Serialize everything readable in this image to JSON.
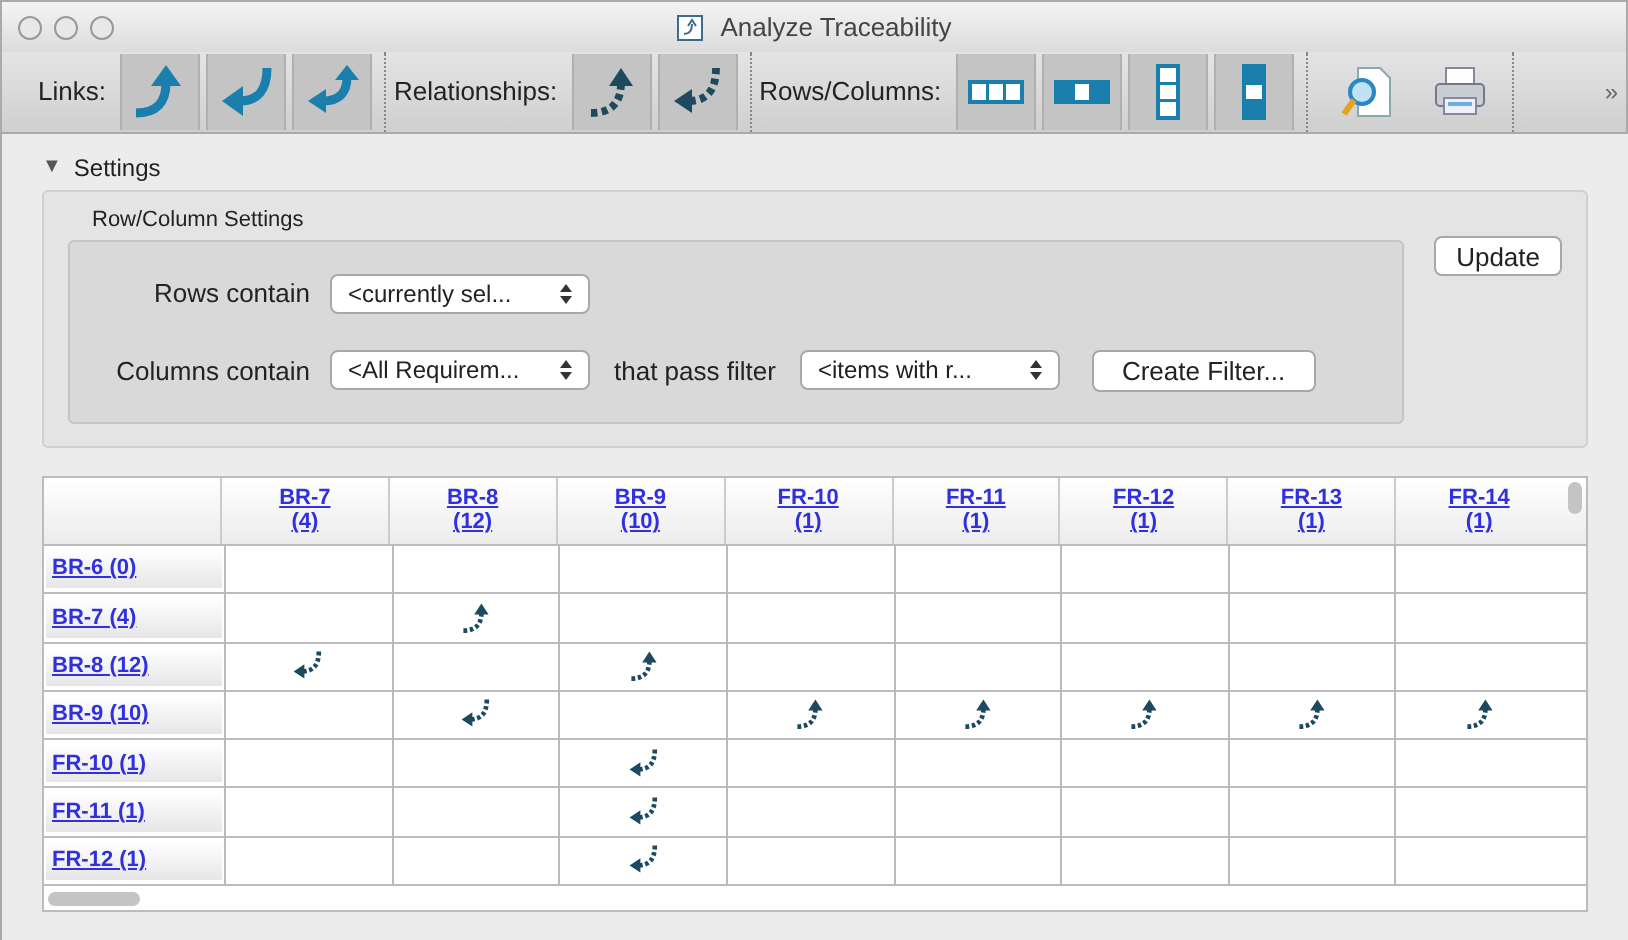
{
  "window": {
    "title": "Analyze Traceability"
  },
  "toolbar": {
    "groups": [
      {
        "label": "Links:",
        "buttons": [
          {
            "kind": "link-out"
          },
          {
            "kind": "link-in"
          },
          {
            "kind": "link-both"
          }
        ]
      },
      {
        "label": "Relationships:",
        "buttons": [
          {
            "kind": "rel-out"
          },
          {
            "kind": "rel-in"
          }
        ]
      },
      {
        "label": "Rows/Columns:",
        "buttons": [
          {
            "kind": "cols-3"
          },
          {
            "kind": "cols-1"
          },
          {
            "kind": "rows-3"
          },
          {
            "kind": "rows-1"
          }
        ]
      }
    ],
    "tools": [
      {
        "kind": "preview"
      },
      {
        "kind": "print"
      }
    ],
    "overflow": "»"
  },
  "settings": {
    "disclosure": "▼",
    "title": "Settings",
    "expanded": true,
    "group_title": "Row/Column Settings",
    "rows_label": "Rows contain",
    "rows_value": "<currently sel...",
    "columns_label": "Columns contain",
    "columns_value": "<All Requirem...",
    "filter_label": "that pass filter",
    "filter_value": "<items with r...",
    "create_filter": "Create Filter...",
    "update": "Update"
  },
  "table": {
    "columns": [
      {
        "id": "BR-7",
        "count": "(4)"
      },
      {
        "id": "BR-8",
        "count": "(12)"
      },
      {
        "id": "BR-9",
        "count": "(10)"
      },
      {
        "id": "FR-10",
        "count": "(1)"
      },
      {
        "id": "FR-11",
        "count": "(1)"
      },
      {
        "id": "FR-12",
        "count": "(1)"
      },
      {
        "id": "FR-13",
        "count": "(1)"
      },
      {
        "id": "FR-14",
        "count": "(1)"
      }
    ],
    "rows": [
      {
        "label": "BR-6 (0)",
        "cells": [
          {
            "kind": "none"
          },
          {
            "kind": "none"
          },
          {
            "kind": "none"
          },
          {
            "kind": "none"
          },
          {
            "kind": "none"
          },
          {
            "kind": "none"
          },
          {
            "kind": "none"
          },
          {
            "kind": "none"
          }
        ]
      },
      {
        "label": "BR-7 (4)",
        "cells": [
          {
            "kind": "none"
          },
          {
            "kind": "out"
          },
          {
            "kind": "none"
          },
          {
            "kind": "none"
          },
          {
            "kind": "none"
          },
          {
            "kind": "none"
          },
          {
            "kind": "none"
          },
          {
            "kind": "none"
          }
        ]
      },
      {
        "label": "BR-8 (12)",
        "cells": [
          {
            "kind": "in"
          },
          {
            "kind": "none"
          },
          {
            "kind": "out"
          },
          {
            "kind": "none"
          },
          {
            "kind": "none"
          },
          {
            "kind": "none"
          },
          {
            "kind": "none"
          },
          {
            "kind": "none"
          }
        ]
      },
      {
        "label": "BR-9 (10)",
        "cells": [
          {
            "kind": "none"
          },
          {
            "kind": "in"
          },
          {
            "kind": "none"
          },
          {
            "kind": "out"
          },
          {
            "kind": "out"
          },
          {
            "kind": "out"
          },
          {
            "kind": "out"
          },
          {
            "kind": "out"
          }
        ]
      },
      {
        "label": "FR-10 (1)",
        "cells": [
          {
            "kind": "none"
          },
          {
            "kind": "none"
          },
          {
            "kind": "in"
          },
          {
            "kind": "none"
          },
          {
            "kind": "none"
          },
          {
            "kind": "none"
          },
          {
            "kind": "none"
          },
          {
            "kind": "none"
          }
        ]
      },
      {
        "label": "FR-11 (1)",
        "cells": [
          {
            "kind": "none"
          },
          {
            "kind": "none"
          },
          {
            "kind": "in"
          },
          {
            "kind": "none"
          },
          {
            "kind": "none"
          },
          {
            "kind": "none"
          },
          {
            "kind": "none"
          },
          {
            "kind": "none"
          }
        ]
      },
      {
        "label": "FR-12 (1)",
        "cells": [
          {
            "kind": "none"
          },
          {
            "kind": "none"
          },
          {
            "kind": "in"
          },
          {
            "kind": "none"
          },
          {
            "kind": "none"
          },
          {
            "kind": "none"
          },
          {
            "kind": "none"
          },
          {
            "kind": "none"
          }
        ]
      }
    ]
  }
}
